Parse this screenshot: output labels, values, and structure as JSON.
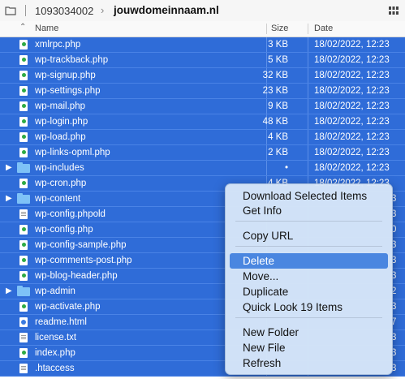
{
  "pathbar": {
    "crumbs": [
      "1093034002",
      "jouwdomeinnaam.nl"
    ],
    "chevron": "›"
  },
  "columns": {
    "sort_indicator": "⌃",
    "name": "Name",
    "size": "Size",
    "date": "Date"
  },
  "rows": [
    {
      "type": "php",
      "name": "xmlrpc.php",
      "size": "3 KB",
      "date": "18/02/2022, 12:23"
    },
    {
      "type": "php",
      "name": "wp-trackback.php",
      "size": "5 KB",
      "date": "18/02/2022, 12:23"
    },
    {
      "type": "php",
      "name": "wp-signup.php",
      "size": "32 KB",
      "date": "18/02/2022, 12:23"
    },
    {
      "type": "php",
      "name": "wp-settings.php",
      "size": "23 KB",
      "date": "18/02/2022, 12:23"
    },
    {
      "type": "php",
      "name": "wp-mail.php",
      "size": "9 KB",
      "date": "18/02/2022, 12:23"
    },
    {
      "type": "php",
      "name": "wp-login.php",
      "size": "48 KB",
      "date": "18/02/2022, 12:23"
    },
    {
      "type": "php",
      "name": "wp-load.php",
      "size": "4 KB",
      "date": "18/02/2022, 12:23"
    },
    {
      "type": "php",
      "name": "wp-links-opml.php",
      "size": "2 KB",
      "date": "18/02/2022, 12:23"
    },
    {
      "type": "folder",
      "name": "wp-includes",
      "size": "•",
      "date": "18/02/2022, 12:23"
    },
    {
      "type": "php",
      "name": "wp-cron.php",
      "size": "4 KB",
      "date": "18/02/2022, 12:23"
    },
    {
      "type": "folder",
      "name": "wp-content",
      "size": "",
      "date": "3"
    },
    {
      "type": "txt",
      "name": "wp-config.phpold",
      "size": "",
      "date": "3"
    },
    {
      "type": "php",
      "name": "wp-config.php",
      "size": "",
      "date": "0"
    },
    {
      "type": "php",
      "name": "wp-config-sample.php",
      "size": "",
      "date": "3"
    },
    {
      "type": "php",
      "name": "wp-comments-post.php",
      "size": "",
      "date": "3"
    },
    {
      "type": "php",
      "name": "wp-blog-header.php",
      "size": "",
      "date": "3"
    },
    {
      "type": "folder",
      "name": "wp-admin",
      "size": "",
      "date": "2"
    },
    {
      "type": "php",
      "name": "wp-activate.php",
      "size": "",
      "date": "3"
    },
    {
      "type": "html",
      "name": "readme.html",
      "size": "",
      "date": "7"
    },
    {
      "type": "txt",
      "name": "license.txt",
      "size": "",
      "date": "3"
    },
    {
      "type": "php",
      "name": "index.php",
      "size": "",
      "date": "3"
    },
    {
      "type": "txt",
      "name": ".htaccess",
      "size": "",
      "date": "3"
    }
  ],
  "context_menu": {
    "groups": [
      [
        "Download Selected Items",
        "Get Info"
      ],
      [
        "Copy URL"
      ],
      [
        "Delete",
        "Move...",
        "Duplicate",
        "Quick Look 19 Items"
      ],
      [
        "New Folder",
        "New File",
        "Refresh"
      ]
    ],
    "active_item": "Delete"
  },
  "colors": {
    "selection": "#2f6cd8",
    "menu_highlight": "#4a86e0",
    "folder": "#7ec2f7"
  }
}
